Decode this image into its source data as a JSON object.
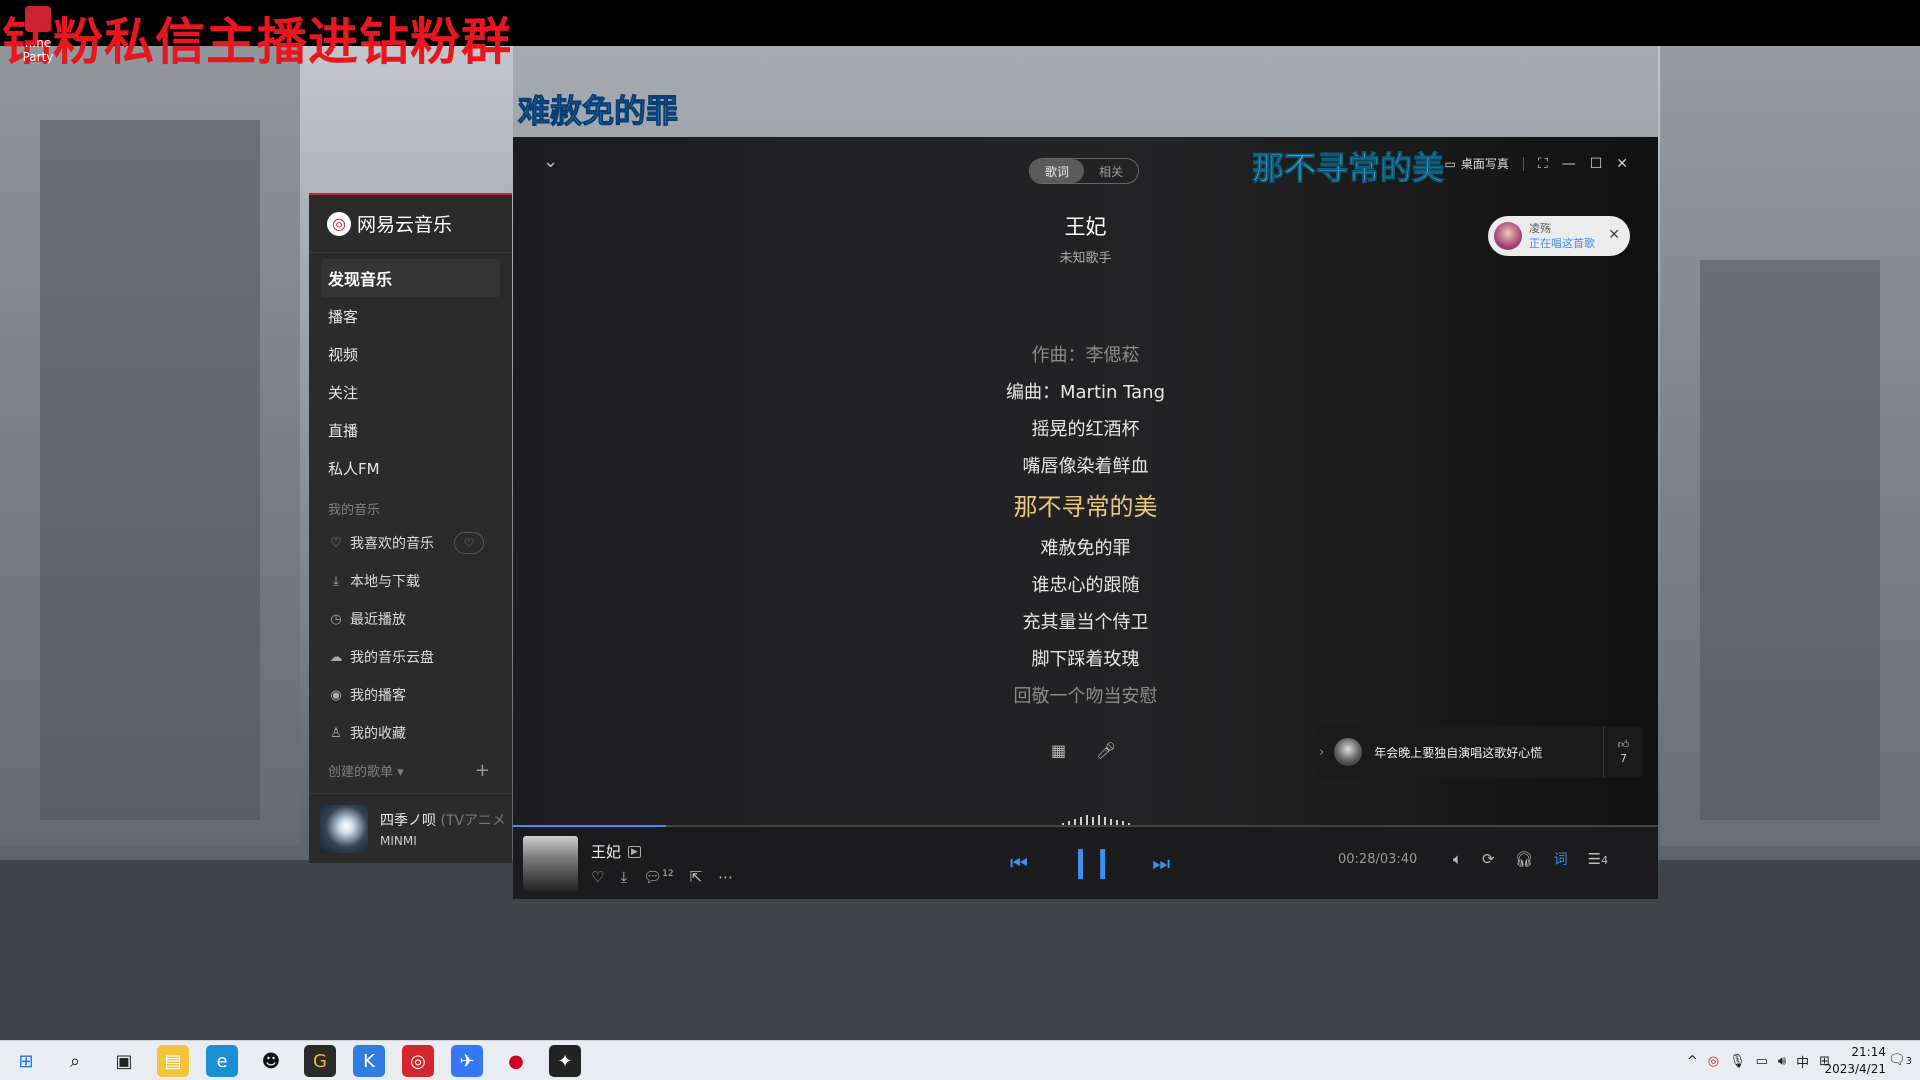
{
  "overlay": {
    "promo_text": "钻粉私信主播进钻粉群"
  },
  "desktop": {
    "icon_label_1": "...ne",
    "icon_label_2": "Party",
    "desk_lyric_left": "难赦免的罪",
    "desk_lyric_right": "那不寻常的美"
  },
  "sidebar": {
    "brand": "网易云音乐",
    "nav": [
      "发现音乐",
      "播客",
      "视频",
      "关注",
      "直播",
      "私人FM"
    ],
    "my_music_label": "我的音乐",
    "my_items": [
      "我喜欢的音乐",
      "本地与下载",
      "最近播放",
      "我的音乐云盘",
      "我的播客",
      "我的收藏"
    ],
    "created_label": "创建的歌单",
    "mini_player": {
      "title": "四季ノ呗",
      "subtitle": "(TVアニメ",
      "artist": "MINMI"
    }
  },
  "player": {
    "tabs": [
      "歌词",
      "相关"
    ],
    "desktop_photo_label": "桌面写真",
    "song_title": "王妃",
    "artist": "未知歌手",
    "listener": {
      "name": "凌殇",
      "status": "正在唱这首歌"
    },
    "lyrics": [
      {
        "text": "作曲：李偲菘",
        "state": "dim"
      },
      {
        "text": "编曲：Martin Tang",
        "state": "normal"
      },
      {
        "text": "摇晃的红酒杯",
        "state": "normal"
      },
      {
        "text": "嘴唇像染着鲜血",
        "state": "normal"
      },
      {
        "text": "那不寻常的美",
        "state": "current"
      },
      {
        "text": "难赦免的罪",
        "state": "normal"
      },
      {
        "text": "谁忠心的跟随",
        "state": "normal"
      },
      {
        "text": "充其量当个侍卫",
        "state": "normal"
      },
      {
        "text": "脚下踩着玫瑰",
        "state": "normal"
      },
      {
        "text": "回敬一个吻当安慰",
        "state": "dim"
      }
    ],
    "comment": {
      "text": "年会晚上要独自演唱这歌好心慌",
      "likes": "7"
    },
    "progress_fraction": 0.134,
    "bottom": {
      "title": "王妃",
      "comment_count": "12",
      "time": "00:28/03:40",
      "lyric_btn": "词",
      "playlist_count": "4"
    }
  },
  "taskbar": {
    "time": "21:14",
    "date": "2023/4/21",
    "ime": "中",
    "notification_count": "3"
  },
  "colors": {
    "accent": "#3f8ef0",
    "current_lyric": "#e9c77f",
    "brand_red": "#c23"
  }
}
